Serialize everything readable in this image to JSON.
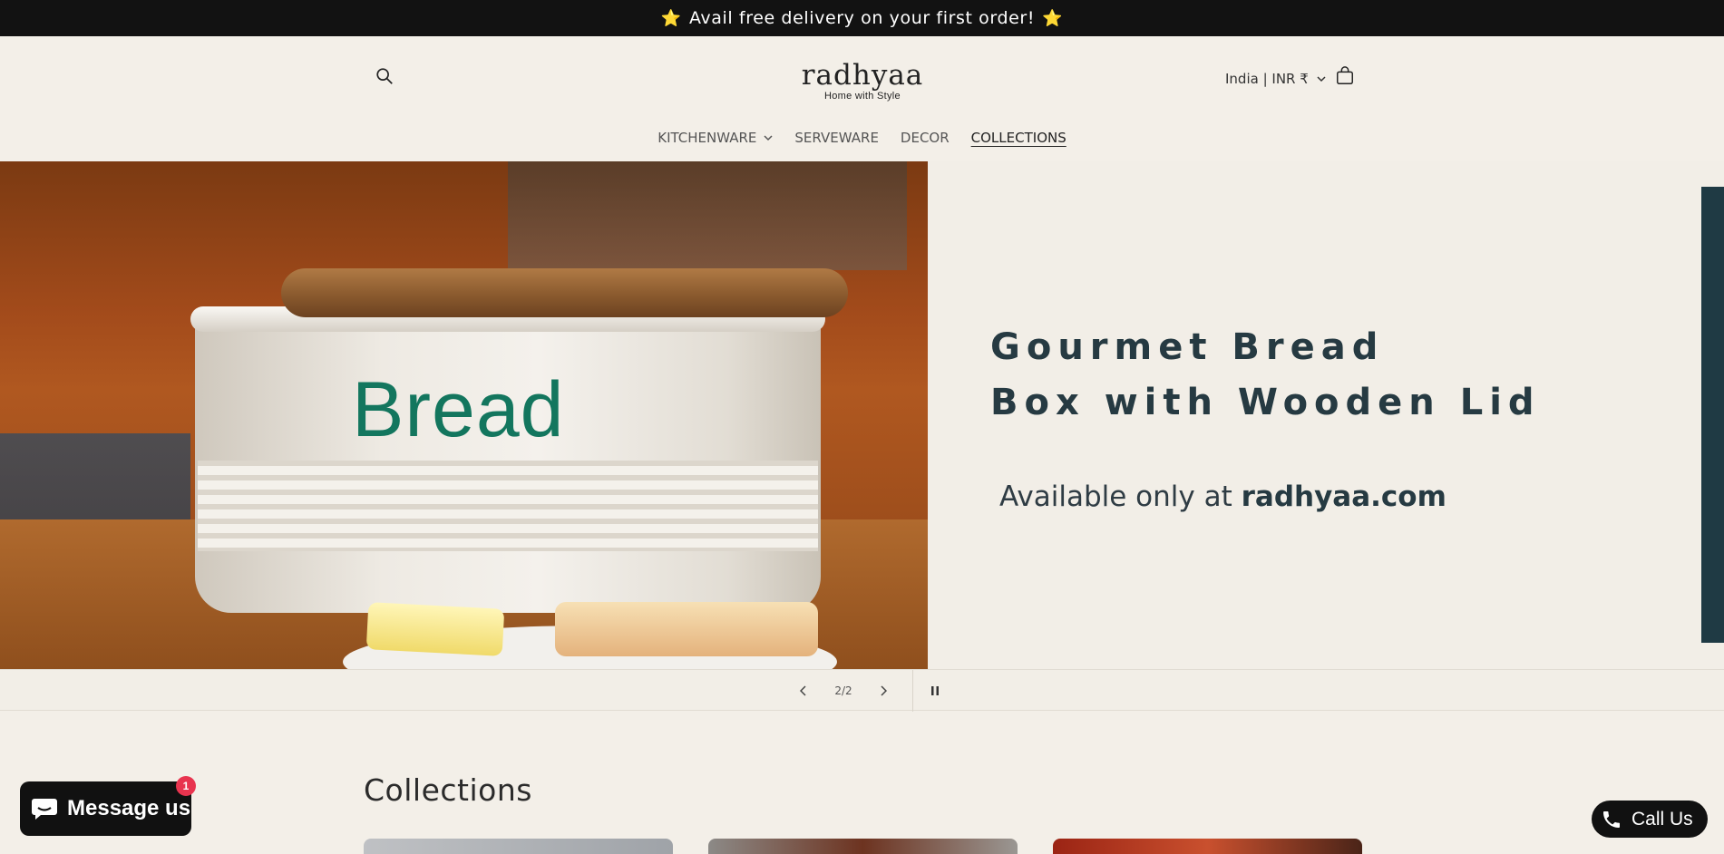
{
  "announcement": {
    "text": "Avail free delivery on your first order!",
    "star": "⭐"
  },
  "header": {
    "logo_name": "radhyaa",
    "logo_tagline": "Home with Style",
    "locale": "India | INR ₹",
    "icons": {
      "search": "search-icon",
      "cart": "cart-icon",
      "chevron": "chevron-down-icon"
    }
  },
  "nav": {
    "items": [
      {
        "label": "KITCHENWARE",
        "has_dropdown": true
      },
      {
        "label": "SERVEWARE"
      },
      {
        "label": "DECOR"
      },
      {
        "label": "COLLECTIONS",
        "active": true
      }
    ]
  },
  "hero": {
    "image_label": "Bread",
    "title_line1": "Gourmet Bread",
    "title_line2": "Box with Wooden Lid",
    "subtitle_prefix": "Available only at ",
    "subtitle_brand": "radhyaa.com"
  },
  "slider": {
    "counter": "2/2",
    "icons": {
      "prev": "chevron-left-icon",
      "next": "chevron-right-icon",
      "pause": "pause-icon"
    }
  },
  "collections": {
    "heading": "Collections"
  },
  "chat": {
    "label": "Message us",
    "badge": "1"
  },
  "call": {
    "label": "Call Us"
  },
  "colors": {
    "accent_dark": "#263a42",
    "announcement_bg": "#121212",
    "page_bg": "#f3efe8",
    "badge": "#e8344f"
  }
}
